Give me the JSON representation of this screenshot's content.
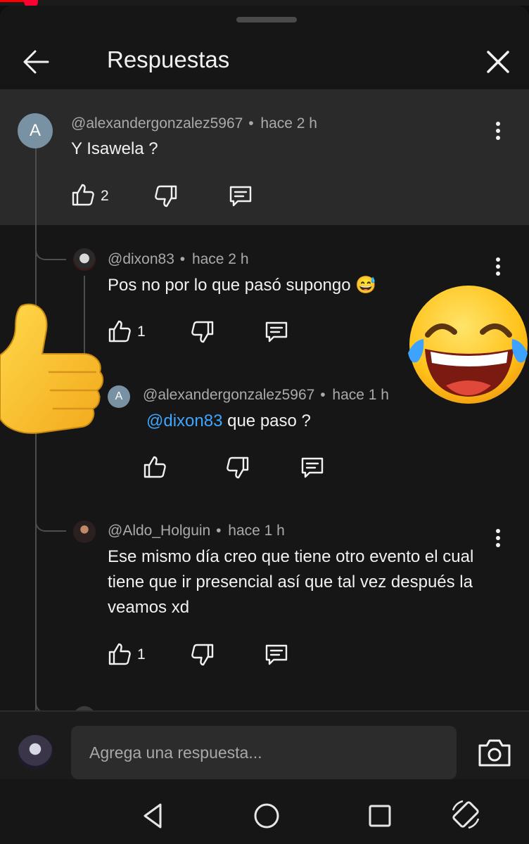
{
  "header": {
    "title": "Respuestas"
  },
  "comments": [
    {
      "avatar_letter": "A",
      "author": "@alexandergonzalez5967",
      "sep": "•",
      "time": "hace 2 h",
      "text": "Y Isawela ?",
      "likes": "2"
    },
    {
      "author": "@dixon83",
      "sep": "•",
      "time": "hace 2 h",
      "text": "Pos no por lo que pasó supongo 😅",
      "likes": "1"
    },
    {
      "avatar_letter": "A",
      "author": "@alexandergonzalez5967",
      "sep": "•",
      "time": "hace 1 h",
      "mention": "@dixon83",
      "text": " que paso ?",
      "likes": ""
    },
    {
      "author": "@Aldo_Holguin",
      "sep": "•",
      "time": "hace 1 h",
      "text": "Ese mismo día creo que tiene otro evento el cual tiene que ir presencial así que tal vez después la veamos xd",
      "likes": "1"
    }
  ],
  "composer": {
    "placeholder": "Agrega una respuesta..."
  },
  "stickers": {
    "left": "thumbs-up-emoji",
    "right": "tears-of-joy-emoji"
  }
}
